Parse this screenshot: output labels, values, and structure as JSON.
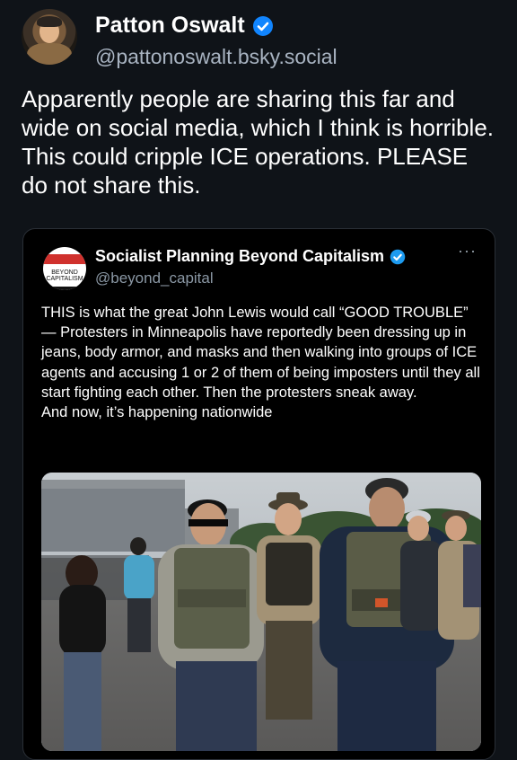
{
  "post": {
    "author_name": "Patton Oswalt",
    "author_handle": "@pattonoswalt.bsky.social",
    "text": "Apparently people are sharing this far and wide on social media, which I think is horrible. This could cripple ICE operations. PLEASE do not share this.",
    "verified_color": "#1185fe"
  },
  "embed": {
    "author_name": "Socialist Planning Beyond Capitalism",
    "author_handle": "@beyond_capital",
    "logo_text": "BEYOND CAPITALISM",
    "more_label": "···",
    "body_line1": "THIS is what the great John Lewis would call “GOOD TROUBLE” — Protesters in Minneapolis have reportedly been dressing up in jeans, body armor, and masks and then walking into groups of ICE agents and accusing 1 or 2 of them of being imposters until they all start fighting each other. Then the protesters sneak away.",
    "body_line2": "And now, it’s happening nationwide",
    "photo": "photo of men in tactical vests walking in a parking lot"
  }
}
